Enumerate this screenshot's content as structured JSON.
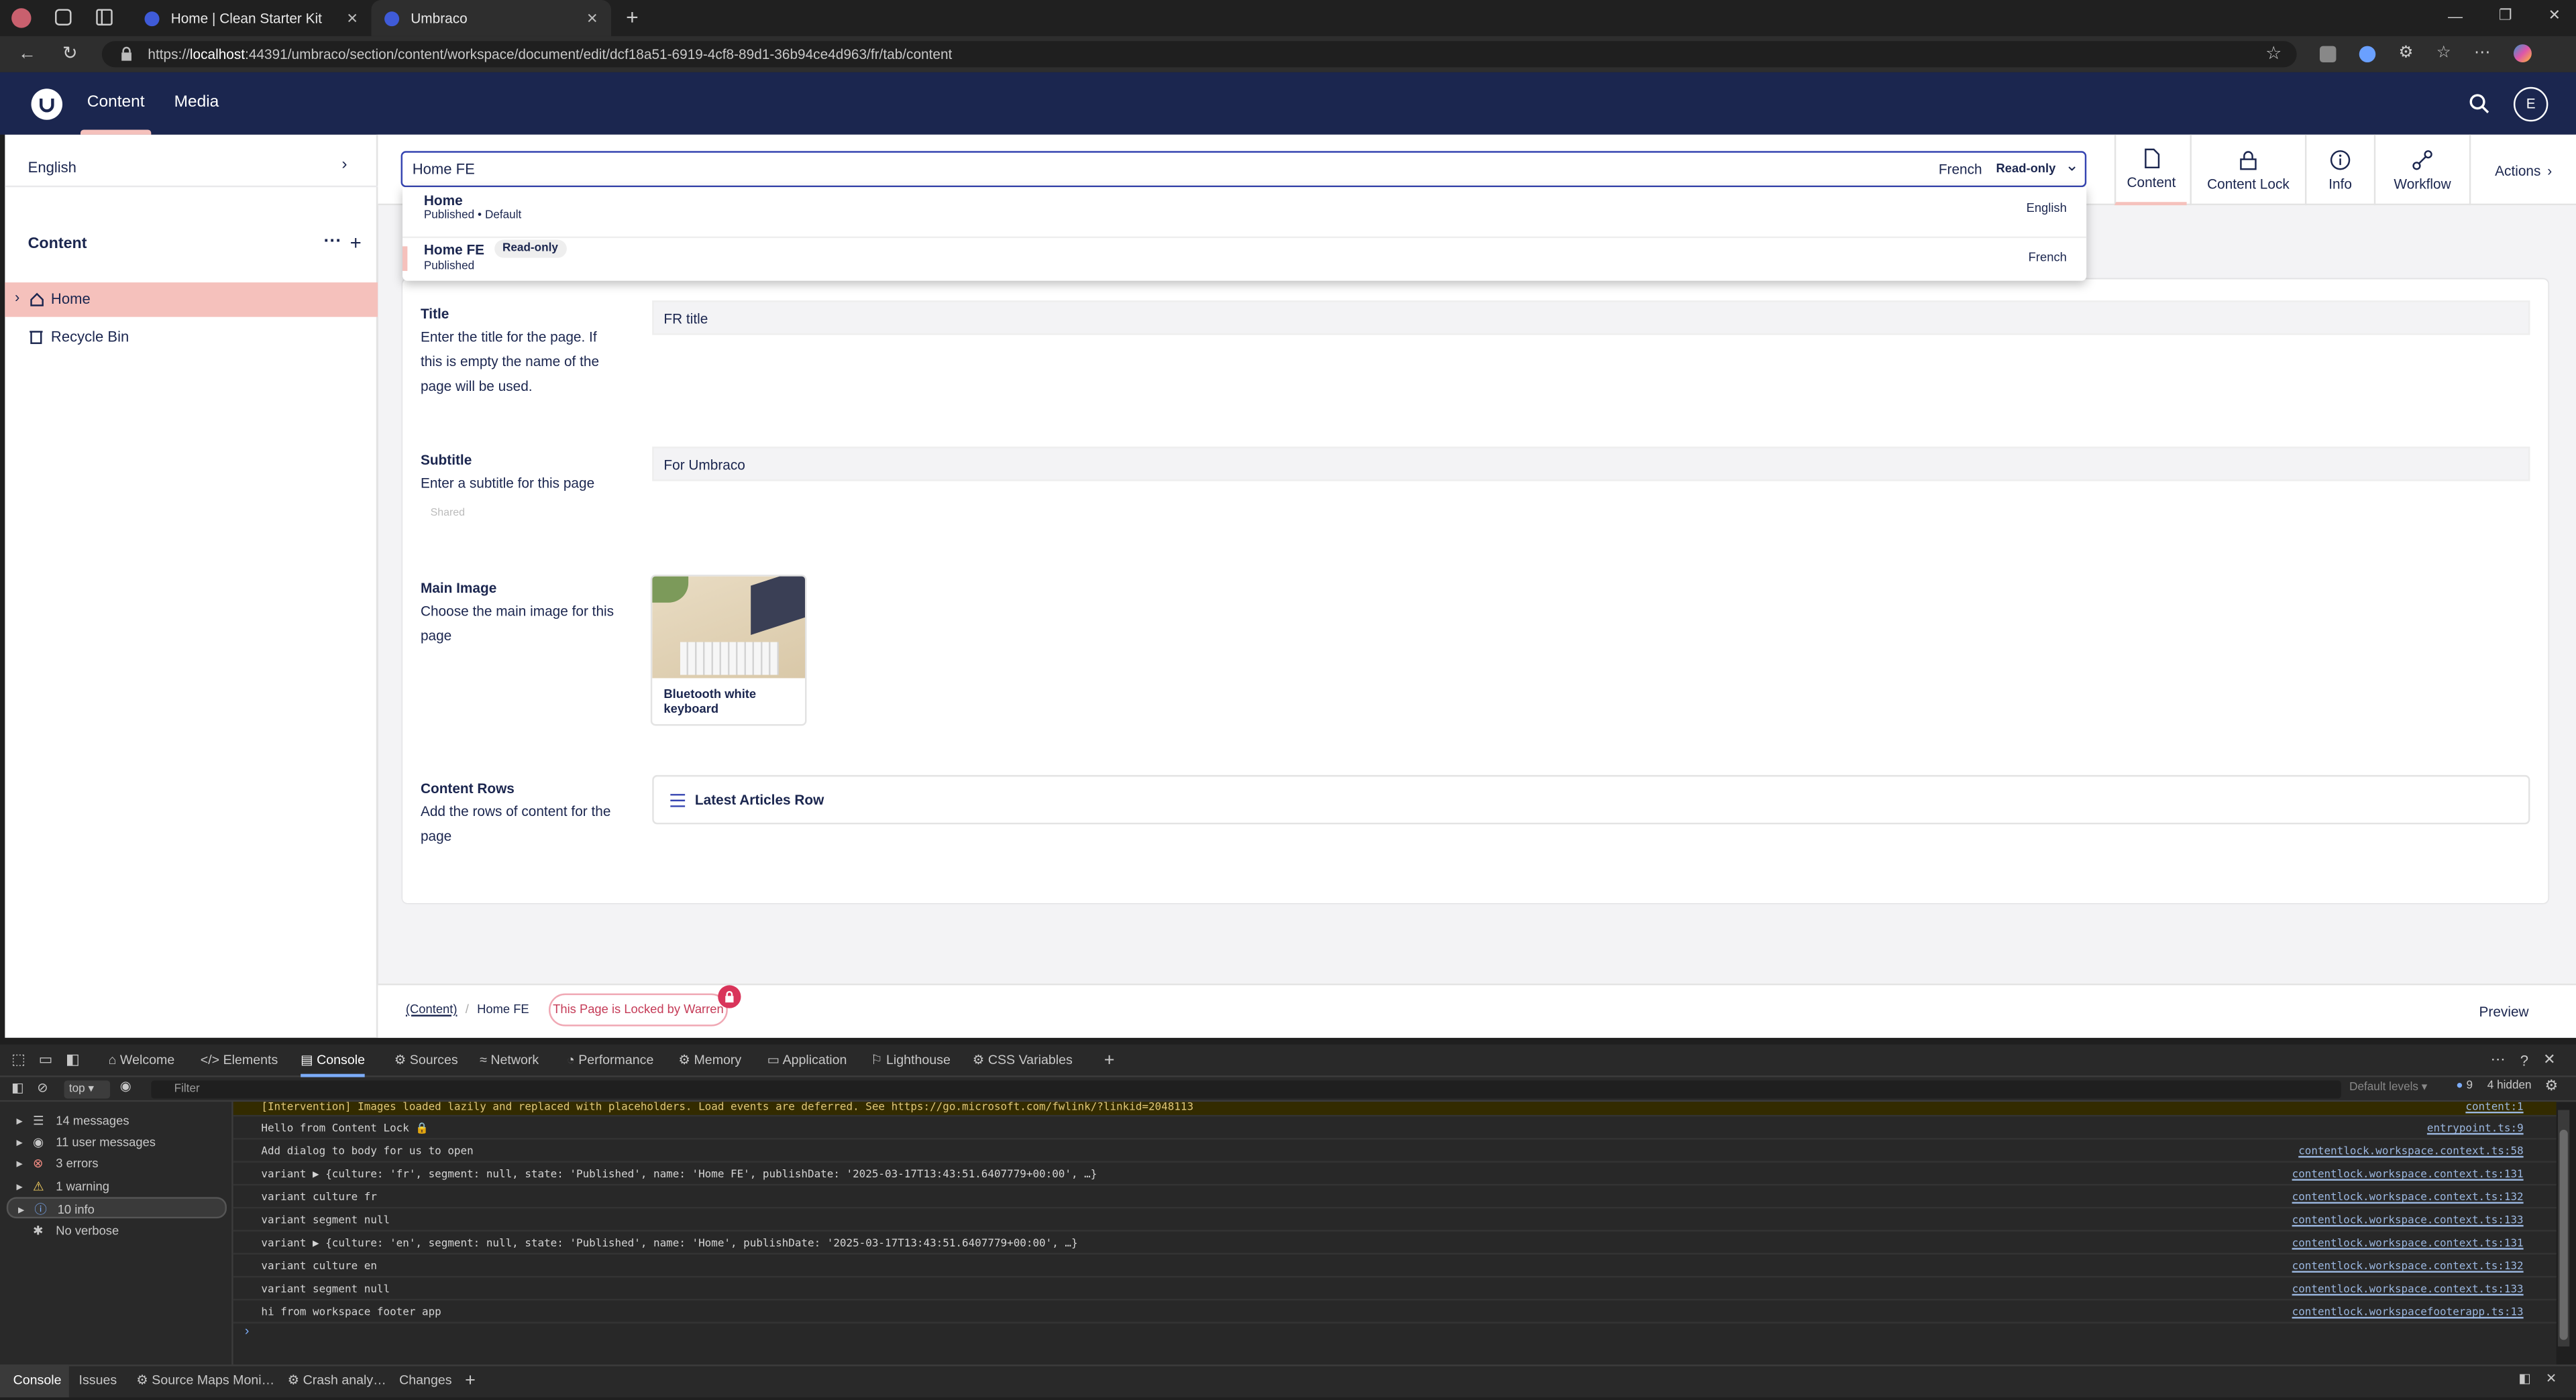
{
  "browser": {
    "tabs": [
      {
        "title": "Home | Clean Starter Kit"
      },
      {
        "title": "Umbraco"
      }
    ],
    "url_prefix": "https://",
    "url_host": "localhost",
    "url_rest": ":44391/umbraco/section/content/workspace/document/edit/dcf18a51-6919-4cf8-89d1-36b94ce4d963/fr/tab/content"
  },
  "header": {
    "sections": [
      "Content",
      "Media"
    ],
    "avatar_initial": "E"
  },
  "sidebar": {
    "culture": "English",
    "title": "Content",
    "items": [
      {
        "label": "Home"
      },
      {
        "label": "Recycle Bin"
      }
    ]
  },
  "workspace": {
    "name_value": "Home FE",
    "culture": "French",
    "readonly": "Read-only",
    "views": [
      "Content",
      "Content Lock",
      "Info",
      "Workflow"
    ],
    "actions": "Actions",
    "variants": [
      {
        "name": "Home",
        "status": "Published",
        "segment": "Default",
        "culture": "English",
        "badge": ""
      },
      {
        "name": "Home FE",
        "status": "Published",
        "segment": "",
        "culture": "French",
        "badge": "Read-only"
      }
    ]
  },
  "properties": {
    "title": {
      "label": "Title",
      "desc": "Enter the title for the page. If this is empty the name of the page will be used.",
      "value": "FR title"
    },
    "subtitle": {
      "label": "Subtitle",
      "desc": "Enter a subtitle for this page",
      "value": "For Umbraco",
      "shared": "Shared"
    },
    "main_image": {
      "label": "Main Image",
      "desc": "Choose the main image for this page",
      "caption": "Bluetooth white keyboard"
    },
    "content_rows": {
      "label": "Content Rows",
      "desc": "Add the rows of content for the page",
      "row": "Latest Articles Row"
    }
  },
  "footer": {
    "crumb_root": "(Content)",
    "crumb_current": "Home FE",
    "lock_text": "This Page is Locked by Warren",
    "preview": "Preview"
  },
  "devtools": {
    "tabs": [
      "Welcome",
      "Elements",
      "Console",
      "Sources",
      "Network",
      "Performance",
      "Memory",
      "Application",
      "Lighthouse",
      "CSS Variables"
    ],
    "context": "top",
    "filter_placeholder": "Filter",
    "levels": "Default levels",
    "issues_count": "9",
    "hidden": "4 hidden",
    "sidebar": [
      "14 messages",
      "11 user messages",
      "3 errors",
      "1 warning",
      "10 info",
      "No verbose"
    ],
    "console": [
      {
        "text": "[Intervention] Images loaded lazily and replaced with placeholders. Load events are deferred. See https://go.microsoft.com/fwlink/?linkid=2048113",
        "src": "content:1"
      },
      {
        "text": "Hello from Content Lock 🔒",
        "src": "entrypoint.ts:9"
      },
      {
        "text": "Add dialog to body for us to open",
        "src": "contentlock.workspace.context.ts:58"
      },
      {
        "text": "variant  ▶ {culture: 'fr', segment: null, state: 'Published', name: 'Home FE', publishDate: '2025-03-17T13:43:51.6407779+00:00', …}",
        "src": "contentlock.workspace.context.ts:131"
      },
      {
        "text": "variant culture fr",
        "src": "contentlock.workspace.context.ts:132"
      },
      {
        "text": "variant segment null",
        "src": "contentlock.workspace.context.ts:133"
      },
      {
        "text": "variant  ▶ {culture: 'en', segment: null, state: 'Published', name: 'Home', publishDate: '2025-03-17T13:43:51.6407779+00:00', …}",
        "src": "contentlock.workspace.context.ts:131"
      },
      {
        "text": "variant culture en",
        "src": "contentlock.workspace.context.ts:132"
      },
      {
        "text": "variant segment null",
        "src": "contentlock.workspace.context.ts:133"
      },
      {
        "text": "hi from workspace footer app",
        "src": "contentlock.workspacefooterapp.ts:13"
      }
    ],
    "drawer_tabs": [
      "Console",
      "Issues",
      "Source Maps Moni…",
      "Crash analy…",
      "Changes"
    ]
  }
}
